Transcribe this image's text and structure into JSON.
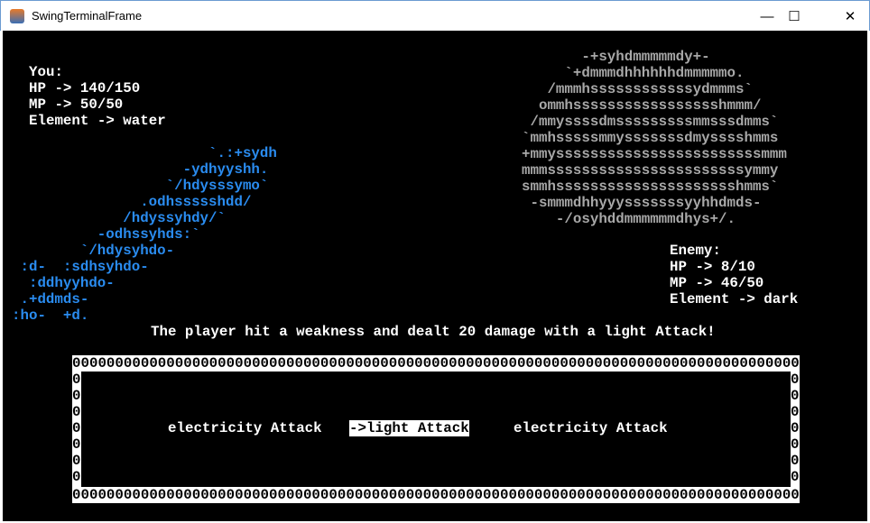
{
  "window": {
    "title": "SwingTerminalFrame",
    "minimize": "—",
    "maximize": "☐",
    "close": "✕"
  },
  "player": {
    "label": "You:",
    "hp": "HP -> 140/150",
    "mp": "MP -> 50/50",
    "element": "Element -> water"
  },
  "enemy": {
    "label": "Enemy:",
    "hp": "HP -> 8/10",
    "mp": "MP -> 46/50",
    "element": "Element -> dark"
  },
  "player_art": [
    "                       `.:+sydh",
    "                    -ydhyyshh.",
    "                  `/hdysssymo`",
    "               .odhssssshdd/",
    "             /hdyssyhdy/`",
    "          -odhssyhds:`",
    "        `/hdysyhdo-",
    " :d-  :sdhsyhdo-",
    "  :ddhyyhdo-",
    " .+ddmds-",
    ":ho-  +d."
  ],
  "enemy_art": [
    "       -+syhdmmmmmdy+-",
    "     `+dmmmdhhhhhhdmmmmmo.",
    "   /mmmhssssssssssssydmmms`",
    "  ommhssssssssssssssssshmmm/",
    " /mmyssssdmsssssssssmmsssdmms`",
    "`mmhsssssmmysssssssdmysssshmms",
    "+mmyssssssssssssssssssssssssmmm",
    "mmmsssssssssssssssssssssssymmy",
    "smmhssssssssssssssssssssshmms`",
    " -smmmdhhyyysssssssyyhhdmds-",
    "    -/osyhddmmmmmmdhys+/."
  ],
  "message": "The player hit a weakness and dealt 20 damage with a light Attack!",
  "box": {
    "border_row": "0000000000000000000000000000000000000000000000000000000000000000000000000000000000000",
    "side": "0\n0\n0\n0\n0\n0\n0"
  },
  "actions": [
    {
      "label": "electricity Attack"
    },
    {
      "label": "->light Attack",
      "selected": true
    },
    {
      "label": "electricity Attack"
    }
  ]
}
